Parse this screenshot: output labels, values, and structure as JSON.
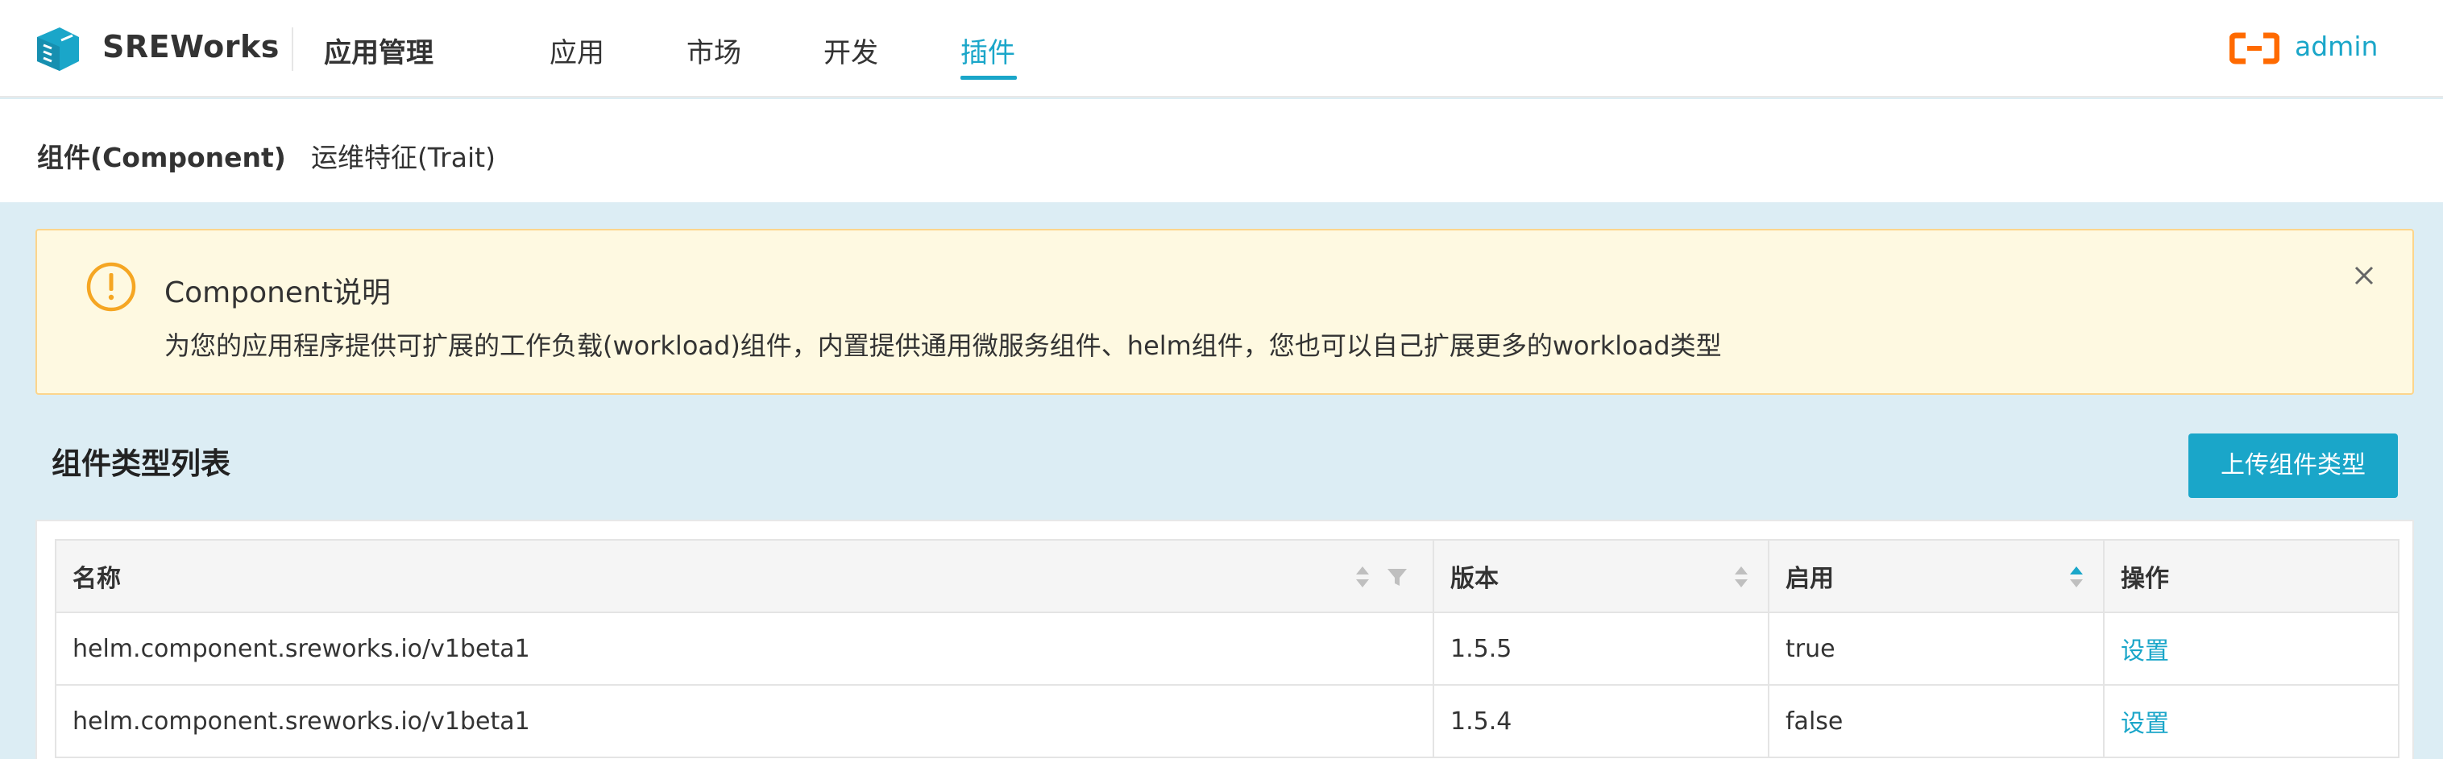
{
  "header": {
    "brand": "SREWorks",
    "app_title": "应用管理",
    "nav": [
      {
        "label": "应用",
        "active": false
      },
      {
        "label": "市场",
        "active": false
      },
      {
        "label": "开发",
        "active": false
      },
      {
        "label": "插件",
        "active": true
      }
    ],
    "user": "admin"
  },
  "subnav": {
    "tabs": [
      {
        "label": "组件(Component)",
        "active": true
      },
      {
        "label": "运维特征(Trait)",
        "active": false
      }
    ]
  },
  "alert": {
    "title": "Component说明",
    "description": "为您的应用程序提供可扩展的工作负载(workload)组件，内置提供通用微服务组件、helm组件，您也可以自己扩展更多的workload类型"
  },
  "section": {
    "title": "组件类型列表",
    "upload_label": "上传组件类型"
  },
  "table": {
    "columns": [
      "名称",
      "版本",
      "启用",
      "操作"
    ],
    "rows": [
      {
        "name": "helm.component.sreworks.io/v1beta1",
        "version": "1.5.5",
        "enabled": "true",
        "action": "设置"
      },
      {
        "name": "helm.component.sreworks.io/v1beta1",
        "version": "1.5.4",
        "enabled": "false",
        "action": "设置"
      }
    ]
  },
  "colors": {
    "accent": "#1aa6c9",
    "alert_bg": "#fef9e1",
    "alert_border": "#fcd58c",
    "warning_icon": "#f5a623",
    "admin_logo": "#ff6a00",
    "page_bg": "#dcedf4"
  }
}
